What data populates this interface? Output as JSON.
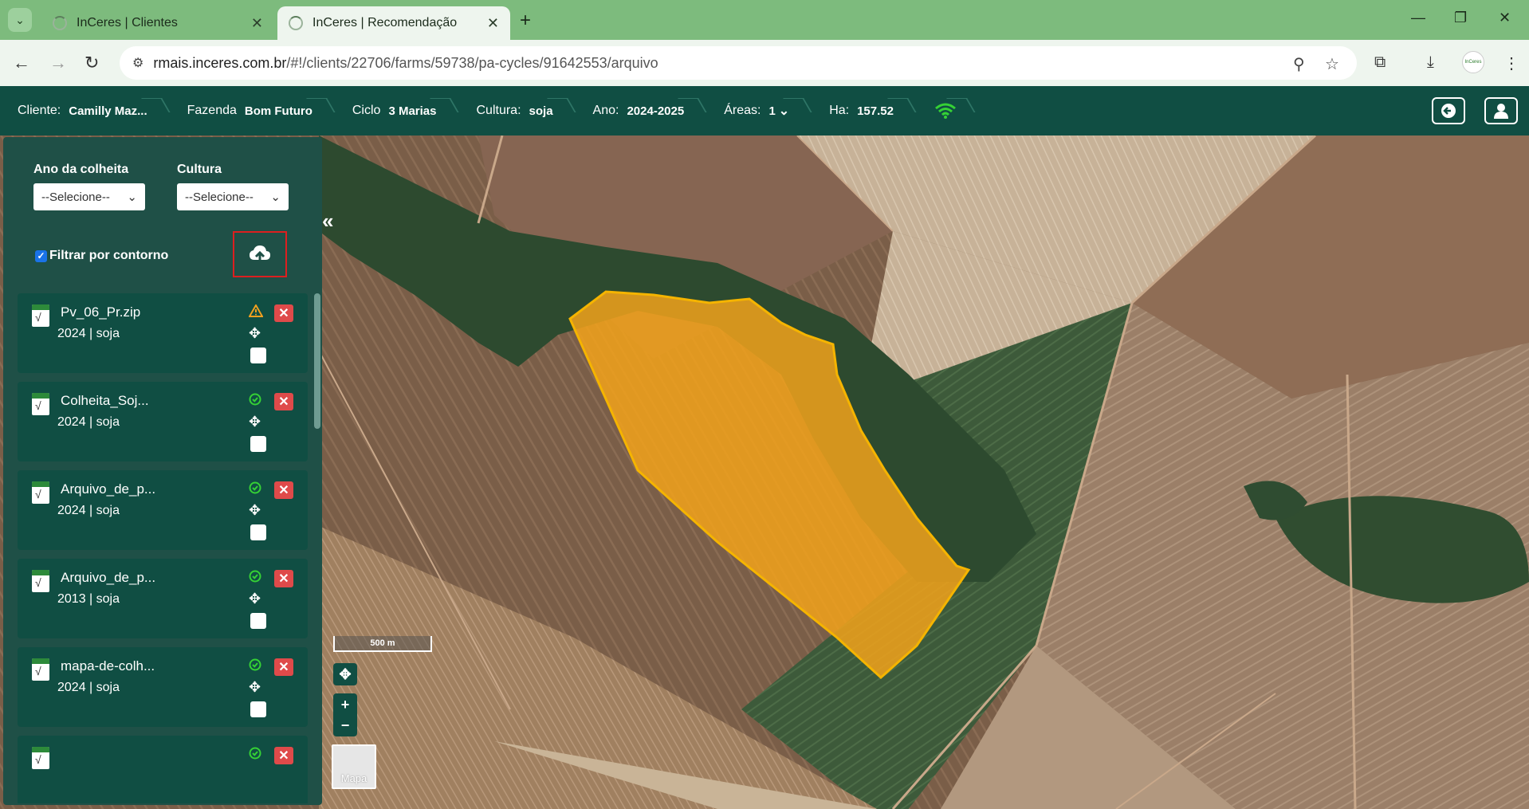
{
  "browser": {
    "tabs": [
      {
        "title": "InCeres | Clientes",
        "close": "✕"
      },
      {
        "title": "InCeres | Recomendação",
        "close": "✕"
      }
    ],
    "new_tab": "+",
    "window_controls": {
      "minimize": "—",
      "restore": "❐",
      "close": "✕"
    },
    "url_host": "rmais.inceres.com.br",
    "url_path": "/#!/clients/22706/farms/59738/pa-cycles/91642553/arquivo",
    "profile_label": "InCeres"
  },
  "header": {
    "client_label": "Cliente:",
    "client_value": "Camilly Maz...",
    "farm_label": "Fazenda",
    "farm_value": "Bom Futuro",
    "cycle_label": "Ciclo",
    "cycle_value": "3 Marias",
    "culture_label": "Cultura:",
    "culture_value": "soja",
    "year_label": "Ano:",
    "year_value": "2024-2025",
    "areas_label": "Áreas:",
    "areas_value": "1",
    "ha_label": "Ha:",
    "ha_value": "157.52"
  },
  "sidebar": {
    "harvest_year_label": "Ano da colheita",
    "harvest_year_select": "--Selecione--",
    "culture_label": "Cultura",
    "culture_select": "--Selecione--",
    "filter_contour_label": "Filtrar por contorno",
    "filter_contour_checked": true,
    "files": [
      {
        "name": "Pv_06_Pr.zip",
        "meta": "2024 | soja",
        "status": "warning"
      },
      {
        "name": "Colheita_Soj...",
        "meta": "2024 | soja",
        "status": "ok"
      },
      {
        "name": "Arquivo_de_p...",
        "meta": "2024 | soja",
        "status": "ok"
      },
      {
        "name": "Arquivo_de_p...",
        "meta": "2013 | soja",
        "status": "ok"
      },
      {
        "name": "mapa-de-colh...",
        "meta": "2024 | soja",
        "status": "ok"
      },
      {
        "name": "",
        "meta": "",
        "status": "ok"
      }
    ]
  },
  "map": {
    "scale_label": "500 m",
    "zoom_in": "+",
    "zoom_out": "−",
    "basemap_label": "Mapa",
    "highlight_color": "#f2a21b"
  }
}
